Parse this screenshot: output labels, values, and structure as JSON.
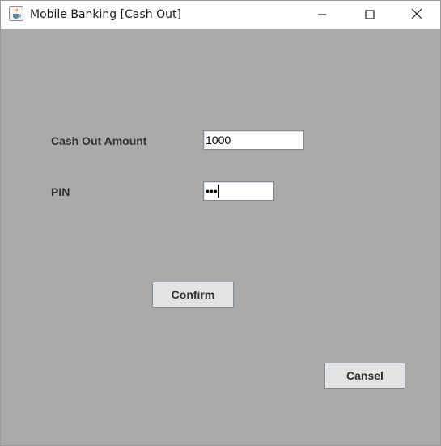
{
  "window": {
    "title": "Mobile Banking [Cash Out]",
    "icon": "java-cup-icon",
    "controls": {
      "minimize_icon": "minimize-icon",
      "maximize_icon": "maximize-icon",
      "close_icon": "close-icon"
    },
    "background_color": "#acaaa8"
  },
  "form": {
    "amount_label": "Cash Out Amount",
    "amount_value": "1000",
    "pin_label": "PIN",
    "pin_masked_value": "•••",
    "confirm_label": "Confirm",
    "cancel_label": "Cansel"
  }
}
